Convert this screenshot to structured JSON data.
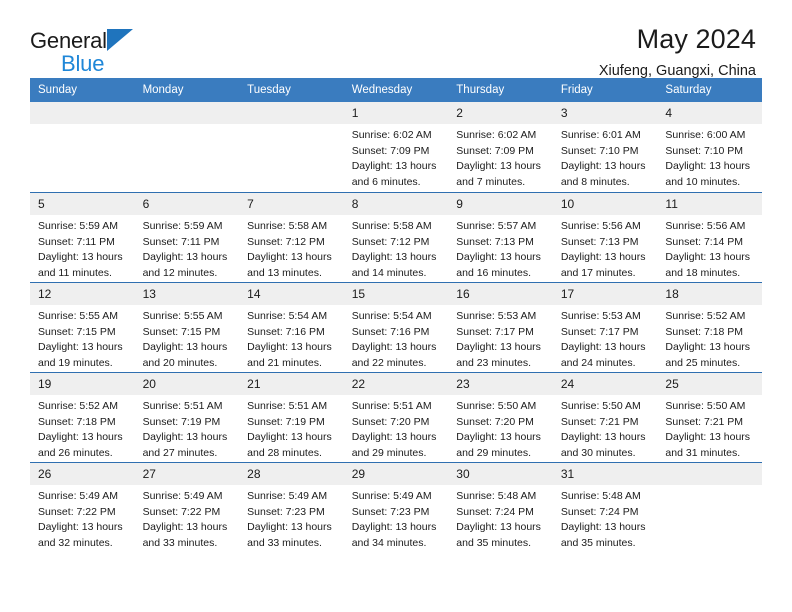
{
  "brand": {
    "line1": "General",
    "line2": "Blue",
    "triangle_color": "#1f74bd",
    "blue_text_color": "#1f87d8"
  },
  "header": {
    "title": "May 2024",
    "subtitle": "Xiufeng, Guangxi, China"
  },
  "theme": {
    "header_blue": "#3a7cbf",
    "row_divider_blue": "#2f6fb0",
    "daynum_background": "#efefef",
    "text_color": "#1b1b1b"
  },
  "calendar": {
    "weekday_headers": [
      "Sunday",
      "Monday",
      "Tuesday",
      "Wednesday",
      "Thursday",
      "Friday",
      "Saturday"
    ],
    "weeks": [
      [
        {
          "day": "",
          "info": ""
        },
        {
          "day": "",
          "info": ""
        },
        {
          "day": "",
          "info": ""
        },
        {
          "day": "1",
          "info": "Sunrise: 6:02 AM\nSunset: 7:09 PM\nDaylight: 13 hours\nand 6 minutes."
        },
        {
          "day": "2",
          "info": "Sunrise: 6:02 AM\nSunset: 7:09 PM\nDaylight: 13 hours\nand 7 minutes."
        },
        {
          "day": "3",
          "info": "Sunrise: 6:01 AM\nSunset: 7:10 PM\nDaylight: 13 hours\nand 8 minutes."
        },
        {
          "day": "4",
          "info": "Sunrise: 6:00 AM\nSunset: 7:10 PM\nDaylight: 13 hours\nand 10 minutes."
        }
      ],
      [
        {
          "day": "5",
          "info": "Sunrise: 5:59 AM\nSunset: 7:11 PM\nDaylight: 13 hours\nand 11 minutes."
        },
        {
          "day": "6",
          "info": "Sunrise: 5:59 AM\nSunset: 7:11 PM\nDaylight: 13 hours\nand 12 minutes."
        },
        {
          "day": "7",
          "info": "Sunrise: 5:58 AM\nSunset: 7:12 PM\nDaylight: 13 hours\nand 13 minutes."
        },
        {
          "day": "8",
          "info": "Sunrise: 5:58 AM\nSunset: 7:12 PM\nDaylight: 13 hours\nand 14 minutes."
        },
        {
          "day": "9",
          "info": "Sunrise: 5:57 AM\nSunset: 7:13 PM\nDaylight: 13 hours\nand 16 minutes."
        },
        {
          "day": "10",
          "info": "Sunrise: 5:56 AM\nSunset: 7:13 PM\nDaylight: 13 hours\nand 17 minutes."
        },
        {
          "day": "11",
          "info": "Sunrise: 5:56 AM\nSunset: 7:14 PM\nDaylight: 13 hours\nand 18 minutes."
        }
      ],
      [
        {
          "day": "12",
          "info": "Sunrise: 5:55 AM\nSunset: 7:15 PM\nDaylight: 13 hours\nand 19 minutes."
        },
        {
          "day": "13",
          "info": "Sunrise: 5:55 AM\nSunset: 7:15 PM\nDaylight: 13 hours\nand 20 minutes."
        },
        {
          "day": "14",
          "info": "Sunrise: 5:54 AM\nSunset: 7:16 PM\nDaylight: 13 hours\nand 21 minutes."
        },
        {
          "day": "15",
          "info": "Sunrise: 5:54 AM\nSunset: 7:16 PM\nDaylight: 13 hours\nand 22 minutes."
        },
        {
          "day": "16",
          "info": "Sunrise: 5:53 AM\nSunset: 7:17 PM\nDaylight: 13 hours\nand 23 minutes."
        },
        {
          "day": "17",
          "info": "Sunrise: 5:53 AM\nSunset: 7:17 PM\nDaylight: 13 hours\nand 24 minutes."
        },
        {
          "day": "18",
          "info": "Sunrise: 5:52 AM\nSunset: 7:18 PM\nDaylight: 13 hours\nand 25 minutes."
        }
      ],
      [
        {
          "day": "19",
          "info": "Sunrise: 5:52 AM\nSunset: 7:18 PM\nDaylight: 13 hours\nand 26 minutes."
        },
        {
          "day": "20",
          "info": "Sunrise: 5:51 AM\nSunset: 7:19 PM\nDaylight: 13 hours\nand 27 minutes."
        },
        {
          "day": "21",
          "info": "Sunrise: 5:51 AM\nSunset: 7:19 PM\nDaylight: 13 hours\nand 28 minutes."
        },
        {
          "day": "22",
          "info": "Sunrise: 5:51 AM\nSunset: 7:20 PM\nDaylight: 13 hours\nand 29 minutes."
        },
        {
          "day": "23",
          "info": "Sunrise: 5:50 AM\nSunset: 7:20 PM\nDaylight: 13 hours\nand 29 minutes."
        },
        {
          "day": "24",
          "info": "Sunrise: 5:50 AM\nSunset: 7:21 PM\nDaylight: 13 hours\nand 30 minutes."
        },
        {
          "day": "25",
          "info": "Sunrise: 5:50 AM\nSunset: 7:21 PM\nDaylight: 13 hours\nand 31 minutes."
        }
      ],
      [
        {
          "day": "26",
          "info": "Sunrise: 5:49 AM\nSunset: 7:22 PM\nDaylight: 13 hours\nand 32 minutes."
        },
        {
          "day": "27",
          "info": "Sunrise: 5:49 AM\nSunset: 7:22 PM\nDaylight: 13 hours\nand 33 minutes."
        },
        {
          "day": "28",
          "info": "Sunrise: 5:49 AM\nSunset: 7:23 PM\nDaylight: 13 hours\nand 33 minutes."
        },
        {
          "day": "29",
          "info": "Sunrise: 5:49 AM\nSunset: 7:23 PM\nDaylight: 13 hours\nand 34 minutes."
        },
        {
          "day": "30",
          "info": "Sunrise: 5:48 AM\nSunset: 7:24 PM\nDaylight: 13 hours\nand 35 minutes."
        },
        {
          "day": "31",
          "info": "Sunrise: 5:48 AM\nSunset: 7:24 PM\nDaylight: 13 hours\nand 35 minutes."
        },
        {
          "day": "",
          "info": ""
        }
      ]
    ]
  }
}
